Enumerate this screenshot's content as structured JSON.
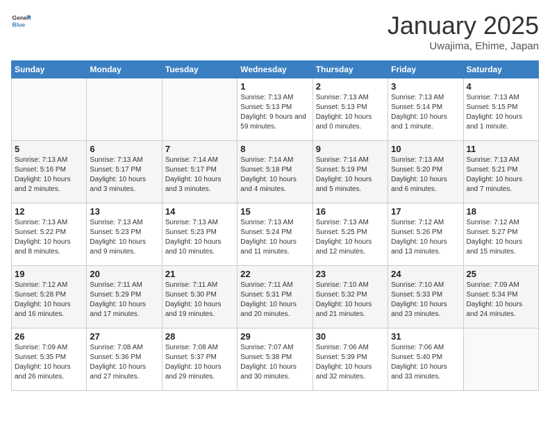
{
  "header": {
    "logo_line1": "General",
    "logo_line2": "Blue",
    "title": "January 2025",
    "subtitle": "Uwajima, Ehime, Japan"
  },
  "weekdays": [
    "Sunday",
    "Monday",
    "Tuesday",
    "Wednesday",
    "Thursday",
    "Friday",
    "Saturday"
  ],
  "weeks": [
    [
      {
        "day": "",
        "info": ""
      },
      {
        "day": "",
        "info": ""
      },
      {
        "day": "",
        "info": ""
      },
      {
        "day": "1",
        "info": "Sunrise: 7:13 AM\nSunset: 5:13 PM\nDaylight: 9 hours and 59 minutes."
      },
      {
        "day": "2",
        "info": "Sunrise: 7:13 AM\nSunset: 5:13 PM\nDaylight: 10 hours and 0 minutes."
      },
      {
        "day": "3",
        "info": "Sunrise: 7:13 AM\nSunset: 5:14 PM\nDaylight: 10 hours and 1 minute."
      },
      {
        "day": "4",
        "info": "Sunrise: 7:13 AM\nSunset: 5:15 PM\nDaylight: 10 hours and 1 minute."
      }
    ],
    [
      {
        "day": "5",
        "info": "Sunrise: 7:13 AM\nSunset: 5:16 PM\nDaylight: 10 hours and 2 minutes."
      },
      {
        "day": "6",
        "info": "Sunrise: 7:13 AM\nSunset: 5:17 PM\nDaylight: 10 hours and 3 minutes."
      },
      {
        "day": "7",
        "info": "Sunrise: 7:14 AM\nSunset: 5:17 PM\nDaylight: 10 hours and 3 minutes."
      },
      {
        "day": "8",
        "info": "Sunrise: 7:14 AM\nSunset: 5:18 PM\nDaylight: 10 hours and 4 minutes."
      },
      {
        "day": "9",
        "info": "Sunrise: 7:14 AM\nSunset: 5:19 PM\nDaylight: 10 hours and 5 minutes."
      },
      {
        "day": "10",
        "info": "Sunrise: 7:13 AM\nSunset: 5:20 PM\nDaylight: 10 hours and 6 minutes."
      },
      {
        "day": "11",
        "info": "Sunrise: 7:13 AM\nSunset: 5:21 PM\nDaylight: 10 hours and 7 minutes."
      }
    ],
    [
      {
        "day": "12",
        "info": "Sunrise: 7:13 AM\nSunset: 5:22 PM\nDaylight: 10 hours and 8 minutes."
      },
      {
        "day": "13",
        "info": "Sunrise: 7:13 AM\nSunset: 5:23 PM\nDaylight: 10 hours and 9 minutes."
      },
      {
        "day": "14",
        "info": "Sunrise: 7:13 AM\nSunset: 5:23 PM\nDaylight: 10 hours and 10 minutes."
      },
      {
        "day": "15",
        "info": "Sunrise: 7:13 AM\nSunset: 5:24 PM\nDaylight: 10 hours and 11 minutes."
      },
      {
        "day": "16",
        "info": "Sunrise: 7:13 AM\nSunset: 5:25 PM\nDaylight: 10 hours and 12 minutes."
      },
      {
        "day": "17",
        "info": "Sunrise: 7:12 AM\nSunset: 5:26 PM\nDaylight: 10 hours and 13 minutes."
      },
      {
        "day": "18",
        "info": "Sunrise: 7:12 AM\nSunset: 5:27 PM\nDaylight: 10 hours and 15 minutes."
      }
    ],
    [
      {
        "day": "19",
        "info": "Sunrise: 7:12 AM\nSunset: 5:28 PM\nDaylight: 10 hours and 16 minutes."
      },
      {
        "day": "20",
        "info": "Sunrise: 7:11 AM\nSunset: 5:29 PM\nDaylight: 10 hours and 17 minutes."
      },
      {
        "day": "21",
        "info": "Sunrise: 7:11 AM\nSunset: 5:30 PM\nDaylight: 10 hours and 19 minutes."
      },
      {
        "day": "22",
        "info": "Sunrise: 7:11 AM\nSunset: 5:31 PM\nDaylight: 10 hours and 20 minutes."
      },
      {
        "day": "23",
        "info": "Sunrise: 7:10 AM\nSunset: 5:32 PM\nDaylight: 10 hours and 21 minutes."
      },
      {
        "day": "24",
        "info": "Sunrise: 7:10 AM\nSunset: 5:33 PM\nDaylight: 10 hours and 23 minutes."
      },
      {
        "day": "25",
        "info": "Sunrise: 7:09 AM\nSunset: 5:34 PM\nDaylight: 10 hours and 24 minutes."
      }
    ],
    [
      {
        "day": "26",
        "info": "Sunrise: 7:09 AM\nSunset: 5:35 PM\nDaylight: 10 hours and 26 minutes."
      },
      {
        "day": "27",
        "info": "Sunrise: 7:08 AM\nSunset: 5:36 PM\nDaylight: 10 hours and 27 minutes."
      },
      {
        "day": "28",
        "info": "Sunrise: 7:08 AM\nSunset: 5:37 PM\nDaylight: 10 hours and 29 minutes."
      },
      {
        "day": "29",
        "info": "Sunrise: 7:07 AM\nSunset: 5:38 PM\nDaylight: 10 hours and 30 minutes."
      },
      {
        "day": "30",
        "info": "Sunrise: 7:06 AM\nSunset: 5:39 PM\nDaylight: 10 hours and 32 minutes."
      },
      {
        "day": "31",
        "info": "Sunrise: 7:06 AM\nSunset: 5:40 PM\nDaylight: 10 hours and 33 minutes."
      },
      {
        "day": "",
        "info": ""
      }
    ]
  ]
}
